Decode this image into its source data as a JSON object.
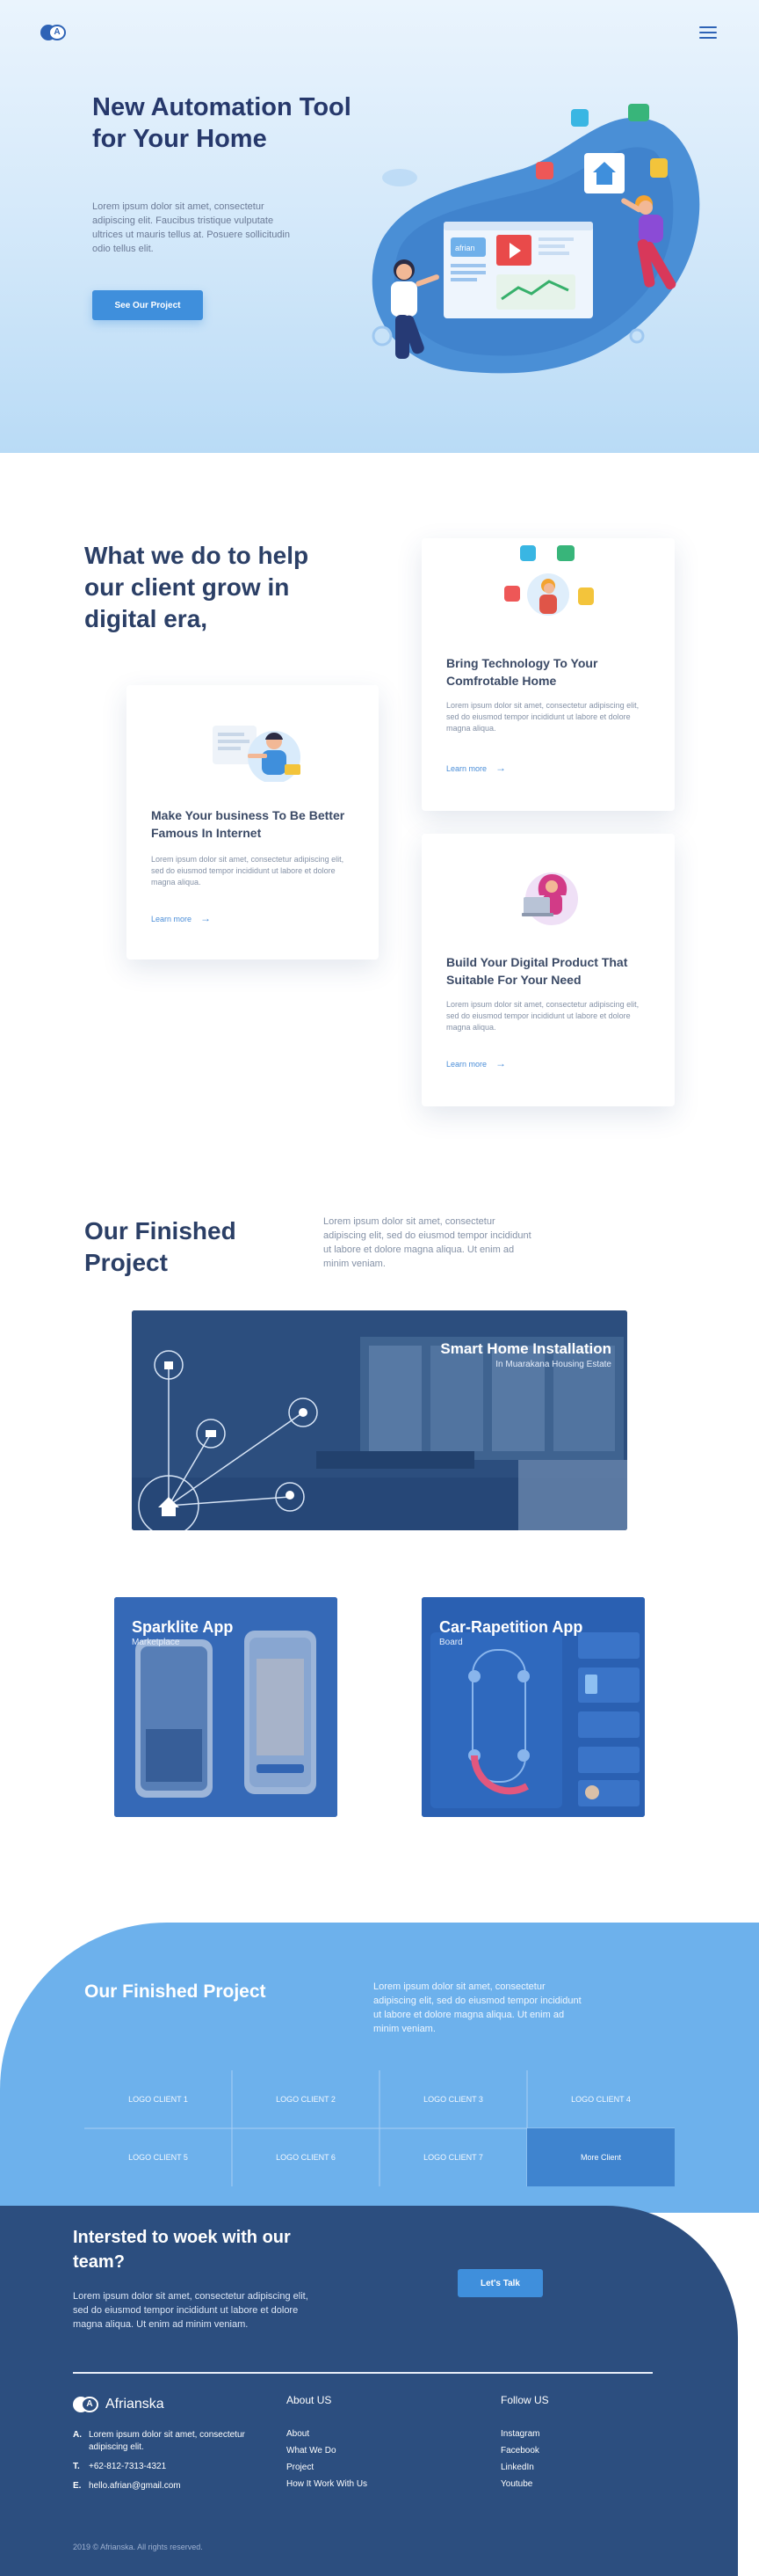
{
  "header": {
    "logo_letter": "A",
    "menu_icon": "hamburger-menu-icon"
  },
  "hero": {
    "title": "New Automation Tool for Your Home",
    "description": "Lorem ipsum dolor sit amet, consectetur adipiscing elit. Faucibus tristique vulputate ultrices ut mauris tellus at. Posuere sollicitudin odio tellus elit.",
    "cta_label": "See Our Project",
    "illustration_window_label": "afrian"
  },
  "services": {
    "title": "What we do to help our client grow in digital era,",
    "cards": [
      {
        "title": "Make Your business To Be Better Famous In Internet",
        "text": "Lorem ipsum dolor sit amet, consectetur adipiscing elit, sed do eiusmod tempor incididunt ut labore et dolore magna aliqua.",
        "link": "Learn more"
      },
      {
        "title": "Bring Technology To Your Comfrotable Home",
        "text": "Lorem ipsum dolor sit amet, consectetur adipiscing elit, sed do eiusmod tempor incididunt ut labore et dolore magna aliqua.",
        "link": "Learn more"
      },
      {
        "title": "Build Your Digital Product That Suitable For Your Need",
        "text": "Lorem ipsum dolor sit amet, consectetur adipiscing elit, sed do eiusmod tempor incididunt ut labore et dolore magna aliqua.",
        "link": "Learn more"
      }
    ]
  },
  "projects": {
    "title": "Our Finished Project",
    "description": "Lorem ipsum dolor sit amet, consectetur adipiscing elit, sed do eiusmod tempor incididunt ut labore et dolore magna aliqua. Ut enim ad minim veniam.",
    "items": [
      {
        "title": "Smart Home Installation",
        "subtitle": "In Muarakana Housing Estate"
      },
      {
        "title": "Sparklite App",
        "subtitle": "Marketplace"
      },
      {
        "title": "Car-Rapetition App",
        "subtitle": "Board"
      }
    ]
  },
  "clients": {
    "title": "Our Finished Project",
    "description": "Lorem ipsum dolor sit amet, consectetur adipiscing elit, sed do eiusmod tempor incididunt ut labore et dolore magna aliqua. Ut enim ad minim veniam.",
    "logos": [
      "LOGO CLIENT 1",
      "LOGO CLIENT 2",
      "LOGO CLIENT 3",
      "LOGO CLIENT 4",
      "LOGO CLIENT 5",
      "LOGO CLIENT 6",
      "LOGO CLIENT 7"
    ],
    "more_label": "More Client"
  },
  "contact": {
    "title": "Intersted to woek with our team?",
    "text": "Lorem ipsum dolor sit amet, consectetur adipiscing elit, sed do eiusmod tempor incididunt ut labore et dolore magna aliqua. Ut enim ad minim veniam.",
    "button": "Let's Talk"
  },
  "footer": {
    "brand": "Afrianska",
    "address": [
      {
        "k": "A.",
        "v": "Lorem ipsum dolor sit amet, consectetur adipiscing elit."
      },
      {
        "k": "T.",
        "v": "+62-812-7313-4321"
      },
      {
        "k": "E.",
        "v": "hello.afrian@gmail.com"
      }
    ],
    "about_title": "About US",
    "about_links": [
      "About",
      "What We Do",
      "Project",
      "How It Work With Us"
    ],
    "follow_title": "Follow US",
    "follow_links": [
      "Instagram",
      "Facebook",
      "LinkedIn",
      "Youtube"
    ],
    "copyright": "2019 © Afrianska. All rights reserved."
  },
  "colors": {
    "primary": "#3f8fdc",
    "navy": "#2c4e7f",
    "sky": "#6db1ec",
    "title": "#26386b"
  }
}
